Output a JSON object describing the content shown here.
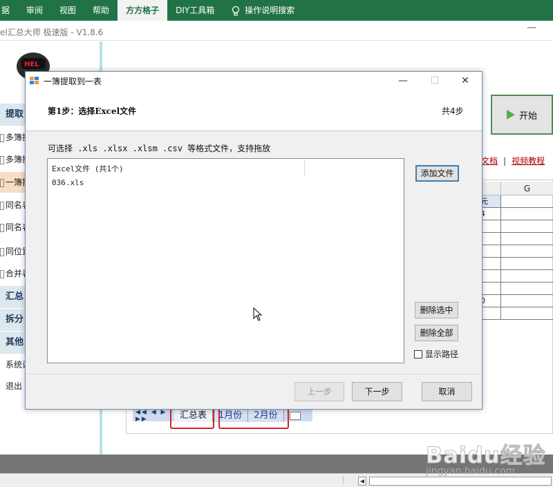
{
  "ribbon": {
    "tabs": [
      {
        "label": "据",
        "active": false
      },
      {
        "label": "审阅",
        "active": false
      },
      {
        "label": "视图",
        "active": false
      },
      {
        "label": "帮助",
        "active": false
      },
      {
        "label": "方方格子",
        "active": true
      },
      {
        "label": "DIY工具箱",
        "active": false
      }
    ],
    "search_label": "操作说明搜索",
    "accent": "#217346"
  },
  "app": {
    "title": "el汇总大师 极速版 - V1.8.6",
    "minimize_glyph": "—",
    "mascot_text": "HEL"
  },
  "sidebar": {
    "sections": [
      {
        "label": "提取"
      },
      {
        "label": "汇总"
      },
      {
        "label": "拆分"
      },
      {
        "label": "其他"
      }
    ],
    "items": [
      {
        "label": "多簿提"
      },
      {
        "label": "多簿提"
      },
      {
        "label": "一簿提"
      },
      {
        "label": "同名表"
      },
      {
        "label": "同名表"
      },
      {
        "label": "同位置"
      },
      {
        "label": "合并表"
      },
      {
        "label": "系统设"
      },
      {
        "label": "退出"
      }
    ]
  },
  "right_panel": {
    "start_label": "开始",
    "link_doc": "文档",
    "link_video": "视频教程",
    "sep": "|"
  },
  "sheet": {
    "column_headers": [
      "",
      "G"
    ],
    "cells": [
      "元",
      "4",
      "",
      "",
      "",
      "",
      "",
      "",
      "0",
      ""
    ],
    "tabs": [
      "汇总表",
      "1月份",
      "2月份"
    ],
    "nav_arrows": "◀◀ ◀ ▶ ▶▶"
  },
  "dialog": {
    "title": "一簿提取到一表",
    "step_title": "第1步：选择Excel文件",
    "step_count": "共4步",
    "hint": "可选择 .xls  .xlsx  .xlsm .csv 等格式文件，支持拖放",
    "list_header": "Excel文件 (共1个)",
    "files": [
      "036.xls"
    ],
    "add_file": "添加文件",
    "delete_selected": "删除选中",
    "delete_all": "删除全部",
    "show_path": "显示路径",
    "show_path_checked": false,
    "prev": "上一步",
    "next": "下一步",
    "cancel": "取消",
    "win_minimize": "—",
    "win_maximize": "☐",
    "win_close": "✕"
  },
  "statusbar": {
    "dots": "⋮"
  },
  "watermark": {
    "brand": "Baidu经验",
    "url": "jingyan.baidu.com"
  }
}
